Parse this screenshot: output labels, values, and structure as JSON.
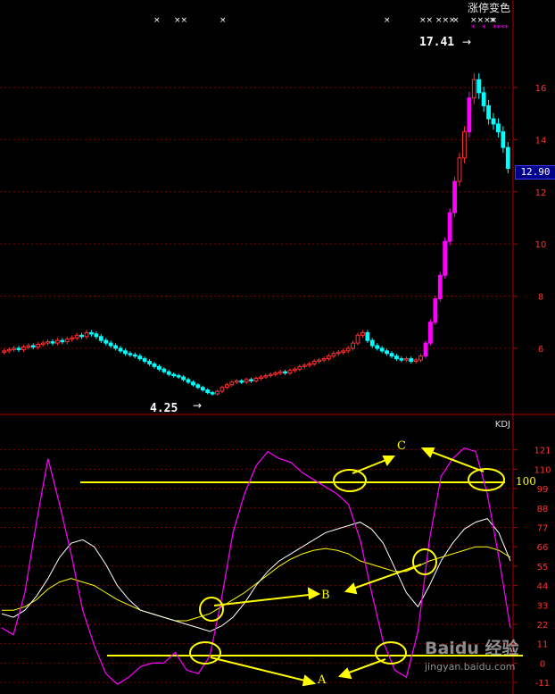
{
  "header": {
    "title": "涨停变色"
  },
  "price_panel": {
    "current_price": "12.90",
    "high_label": "17.41",
    "low_label": "4.25",
    "y_ticks": [
      6,
      8,
      10,
      12,
      14,
      16
    ],
    "y_range": [
      3.6,
      18.5
    ]
  },
  "kdj_panel": {
    "title": "KDJ",
    "y_ticks": [
      -11,
      0,
      11,
      22,
      33,
      44,
      55,
      66,
      77,
      88,
      99,
      110,
      121
    ],
    "y_range": [
      -14,
      133
    ],
    "ref_line_label": "100"
  },
  "annotations": {
    "a": "A",
    "b": "B",
    "c": "C"
  },
  "watermark": {
    "logo": "Baidu 经验",
    "url": "jingyan.baidu.com"
  },
  "colors": {
    "up": "#ff3232",
    "down": "#00ffff",
    "limit_up": "#ff00ff",
    "k_line": "#ffffff",
    "d_line": "#ffff00",
    "j_line": "#ff00ff",
    "grid": "#8b0000",
    "annotation": "#ffff00"
  },
  "chart_data": [
    {
      "type": "candlestick",
      "title": "",
      "note": "daily price series, values read approximately from the price axis (no dates shown)",
      "close": [
        5.9,
        5.95,
        6.0,
        5.95,
        6.05,
        6.1,
        6.05,
        6.15,
        6.2,
        6.25,
        6.2,
        6.3,
        6.25,
        6.35,
        6.4,
        6.5,
        6.45,
        6.6,
        6.55,
        6.45,
        6.3,
        6.2,
        6.1,
        6.0,
        5.9,
        5.8,
        5.75,
        5.7,
        5.6,
        5.5,
        5.4,
        5.3,
        5.2,
        5.1,
        5.0,
        4.95,
        4.9,
        4.8,
        4.7,
        4.6,
        4.5,
        4.4,
        4.3,
        4.25,
        4.35,
        4.5,
        4.6,
        4.7,
        4.75,
        4.7,
        4.8,
        4.75,
        4.85,
        4.9,
        4.95,
        5.0,
        5.05,
        5.1,
        5.05,
        5.15,
        5.2,
        5.3,
        5.35,
        5.4,
        5.5,
        5.55,
        5.6,
        5.7,
        5.8,
        5.85,
        5.9,
        6.0,
        6.2,
        6.5,
        6.6,
        6.3,
        6.1,
        6.0,
        5.9,
        5.8,
        5.7,
        5.6,
        5.55,
        5.6,
        5.5,
        5.55,
        5.7,
        6.2,
        7.0,
        7.9,
        8.8,
        10.1,
        11.2,
        12.4,
        13.3,
        14.3,
        15.6,
        16.3,
        15.8,
        15.3,
        14.8,
        14.6,
        14.3,
        13.7,
        12.9
      ],
      "high": 17.41,
      "low": 4.25,
      "current": 12.9,
      "ylim": [
        3.6,
        18.5
      ],
      "yticks": [
        6,
        8,
        10,
        12,
        14,
        16
      ]
    },
    {
      "type": "line",
      "title": "KDJ",
      "note": "K, D, J indicator lines, values read approximately from the KDJ axis",
      "ylim": [
        -14,
        133
      ],
      "yticks": [
        -11,
        0,
        11,
        22,
        33,
        44,
        55,
        66,
        77,
        88,
        99,
        110,
        121
      ],
      "reference_lines": [
        {
          "y": 100,
          "label": "100"
        },
        {
          "y": 0,
          "label": ""
        }
      ],
      "series": [
        {
          "key": "K",
          "values": [
            28,
            26,
            30,
            38,
            48,
            60,
            68,
            70,
            66,
            56,
            44,
            36,
            30,
            28,
            26,
            24,
            22,
            20,
            18,
            21,
            26,
            34,
            44,
            52,
            58,
            62,
            66,
            70,
            74,
            76,
            78,
            80,
            76,
            68,
            54,
            40,
            32,
            44,
            58,
            68,
            76,
            80,
            82,
            74,
            58
          ]
        },
        {
          "key": "D",
          "values": [
            30,
            30,
            32,
            36,
            42,
            46,
            48,
            46,
            44,
            40,
            36,
            33,
            30,
            28,
            26,
            24,
            24,
            26,
            28,
            32,
            36,
            40,
            45,
            50,
            55,
            59,
            62,
            64,
            65,
            64,
            62,
            58,
            56,
            54,
            52,
            52,
            55,
            58,
            60,
            62,
            64,
            66,
            66,
            64,
            60
          ]
        },
        {
          "key": "J",
          "values": [
            20,
            16,
            40,
            80,
            116,
            90,
            62,
            30,
            10,
            -6,
            -12,
            -8,
            -2,
            0,
            0,
            6,
            -4,
            -6,
            4,
            36,
            74,
            96,
            112,
            120,
            116,
            114,
            108,
            104,
            100,
            96,
            90,
            70,
            40,
            12,
            -4,
            -8,
            18,
            70,
            106,
            116,
            122,
            120,
            96,
            60,
            20
          ]
        }
      ]
    }
  ]
}
